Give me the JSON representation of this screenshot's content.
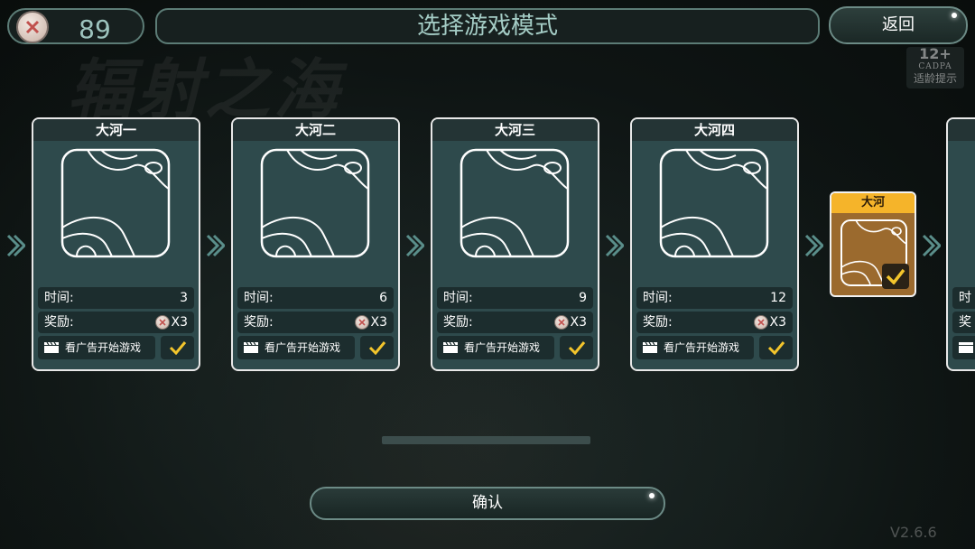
{
  "header": {
    "currency_count": "89",
    "title": "选择游戏模式",
    "back_label": "返回"
  },
  "age_badge": {
    "number": "12+",
    "org": "CADPA",
    "tip": "适龄提示"
  },
  "background_title": "辐射之海",
  "cards": [
    {
      "title": "大河一",
      "time_label": "时间:",
      "time": "3",
      "reward_label": "奖励:",
      "reward": "X3",
      "ad_label": "看广告开始游戏"
    },
    {
      "title": "大河二",
      "time_label": "时间:",
      "time": "6",
      "reward_label": "奖励:",
      "reward": "X3",
      "ad_label": "看广告开始游戏"
    },
    {
      "title": "大河三",
      "time_label": "时间:",
      "time": "9",
      "reward_label": "奖励:",
      "reward": "X3",
      "ad_label": "看广告开始游戏"
    },
    {
      "title": "大河四",
      "time_label": "时间:",
      "time": "12",
      "reward_label": "奖励:",
      "reward": "X3",
      "ad_label": "看广告开始游戏"
    }
  ],
  "selected_card": {
    "title": "大河"
  },
  "partial_card": {
    "time_label": "时",
    "reward_label": "奖"
  },
  "confirm_label": "确认",
  "version": "V2.6.6",
  "colors": {
    "accent_gold": "#f5b42a",
    "card_bg": "#2e4a4c",
    "check_yellow": "#f3c52c",
    "arrow_teal": "#5a8e8a"
  }
}
